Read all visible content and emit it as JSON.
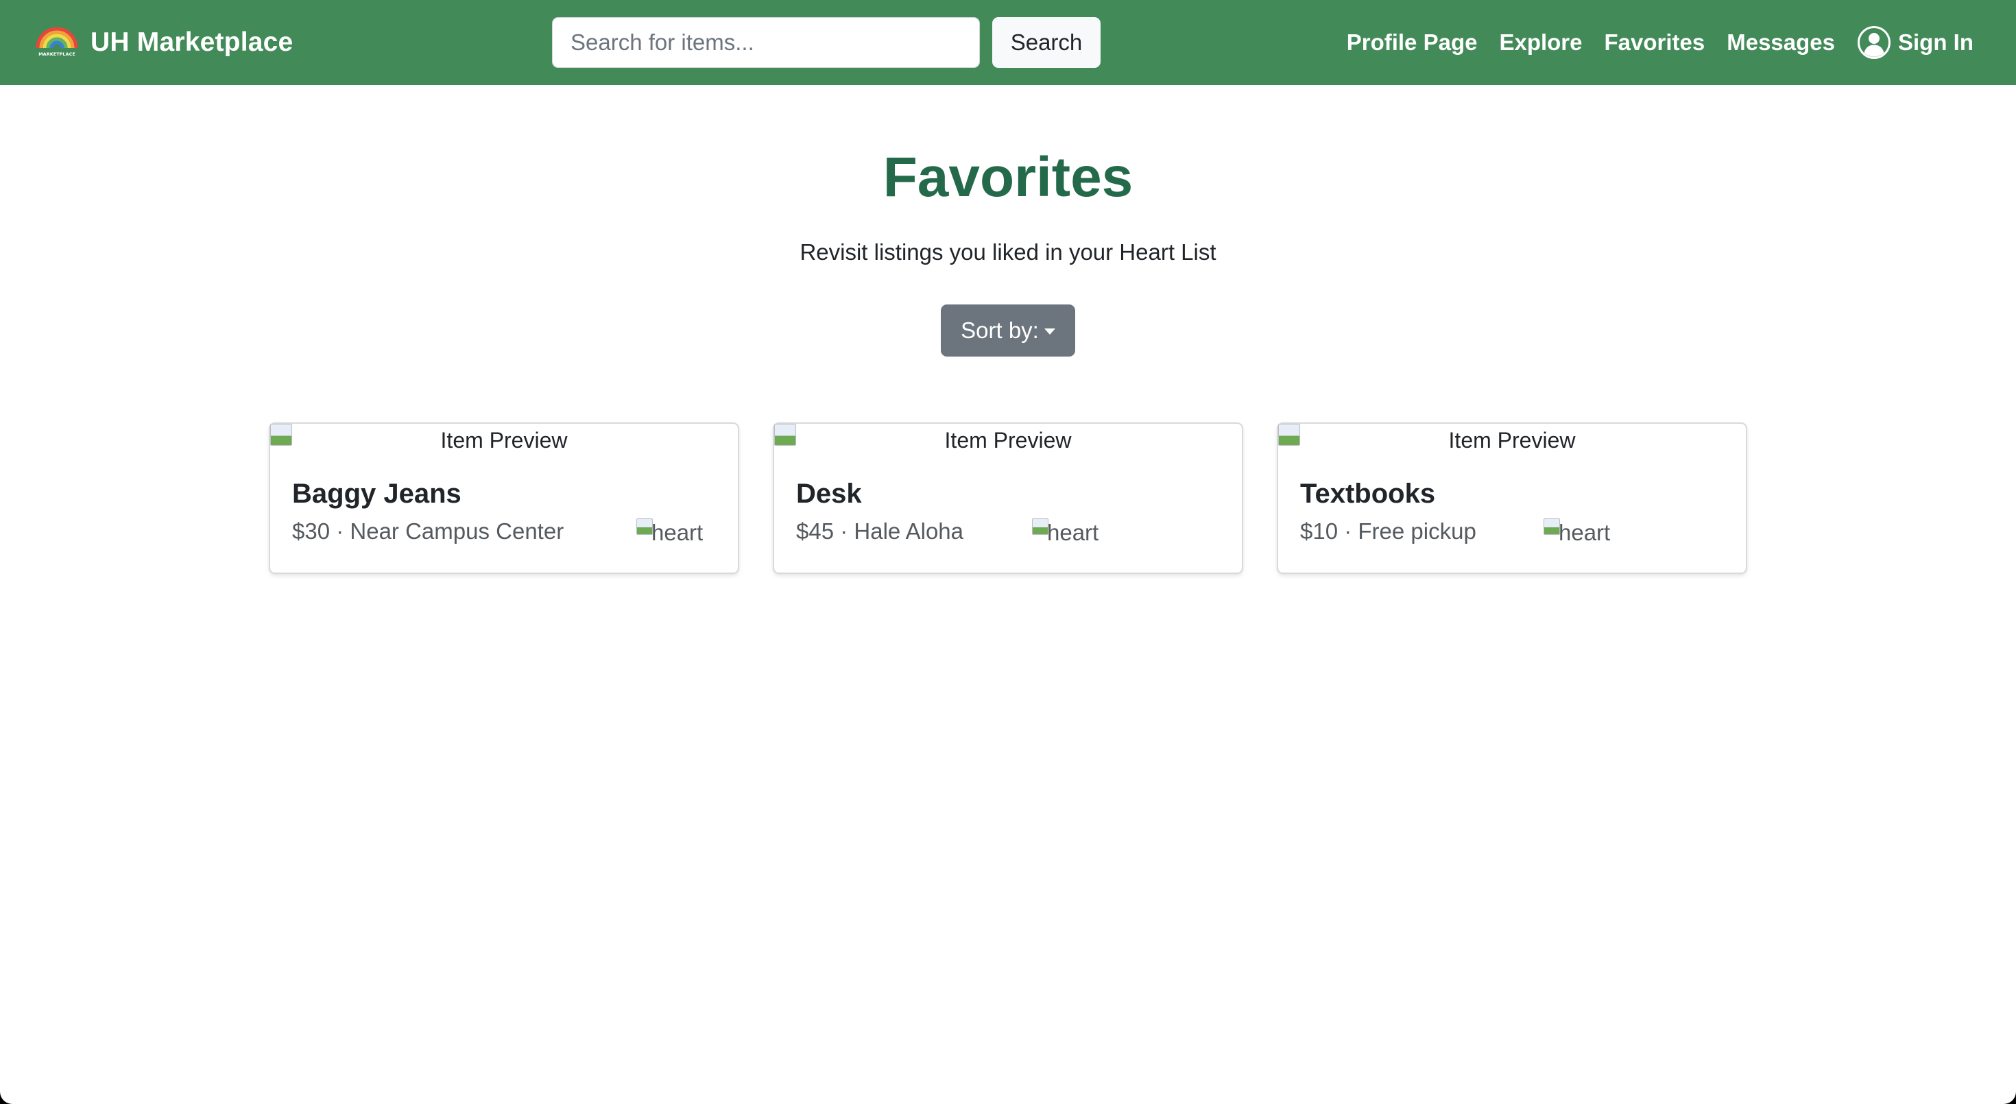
{
  "colors": {
    "navbar_bg": "#428a58",
    "title_green": "#23694a",
    "sort_button_bg": "#6c757d"
  },
  "navbar": {
    "brand_logo_text": "UH MARKETPLACE",
    "brand_title": "UH Marketplace",
    "search_placeholder": "Search for items...",
    "search_button_label": "Search",
    "links": [
      {
        "label": "Profile Page"
      },
      {
        "label": "Explore"
      },
      {
        "label": "Favorites"
      },
      {
        "label": "Messages"
      },
      {
        "label": "Sign In",
        "icon": "user-circle-icon"
      }
    ]
  },
  "header": {
    "title": "Favorites",
    "subtitle": "Revisit listings you liked in your Heart List",
    "sort_label": "Sort by:"
  },
  "cards": [
    {
      "preview_alt": "Item Preview",
      "title": "Baggy Jeans",
      "meta": "$30 · Near Campus Center",
      "heart_alt": "heart"
    },
    {
      "preview_alt": "Item Preview",
      "title": "Desk",
      "meta": "$45 · Hale Aloha",
      "heart_alt": "heart"
    },
    {
      "preview_alt": "Item Preview",
      "title": "Textbooks",
      "meta": "$10 · Free pickup",
      "heart_alt": "heart"
    }
  ]
}
